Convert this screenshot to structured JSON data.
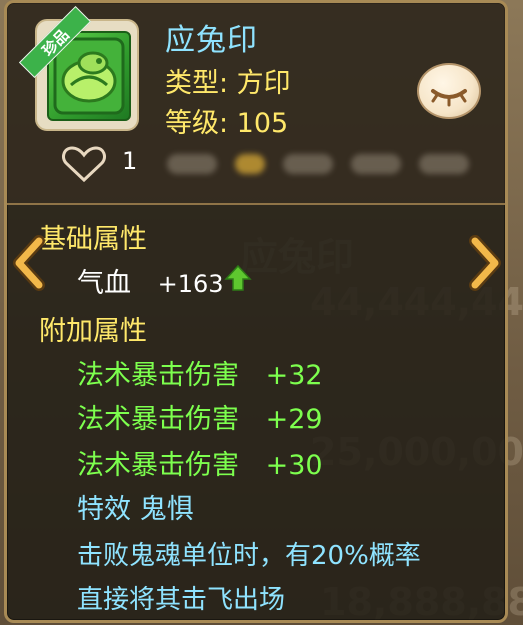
{
  "item": {
    "rarity_badge": "珍品",
    "name": "应兔印",
    "type_line": "类型: 方印",
    "level_line": "等级: 105"
  },
  "social": {
    "likes": "1"
  },
  "base_section": {
    "heading": "基础属性",
    "stat_label": "气血",
    "stat_value": "+163"
  },
  "extra_section": {
    "heading": "附加属性",
    "stats": [
      {
        "label": "法术暴击伤害",
        "value": "+32"
      },
      {
        "label": "法术暴击伤害",
        "value": "+29"
      },
      {
        "label": "法术暴击伤害",
        "value": "+30"
      }
    ]
  },
  "special_effect": {
    "title": "特效 鬼惧",
    "description_lines": [
      "击败鬼魂单位时，有20%概率",
      "直接将其击飞出场"
    ]
  },
  "colors": {
    "title": "#8fe3ff",
    "yellow_text": "#ffe86a",
    "green_text": "#7dff4e",
    "up_arrow": "#5ec72f"
  },
  "icons": {
    "eye": "closed-eye-icon",
    "heart": "heart-outline-icon",
    "arrow_left": "chevron-left-icon",
    "arrow_right": "chevron-right-icon",
    "stat_up": "up-arrow-icon"
  }
}
